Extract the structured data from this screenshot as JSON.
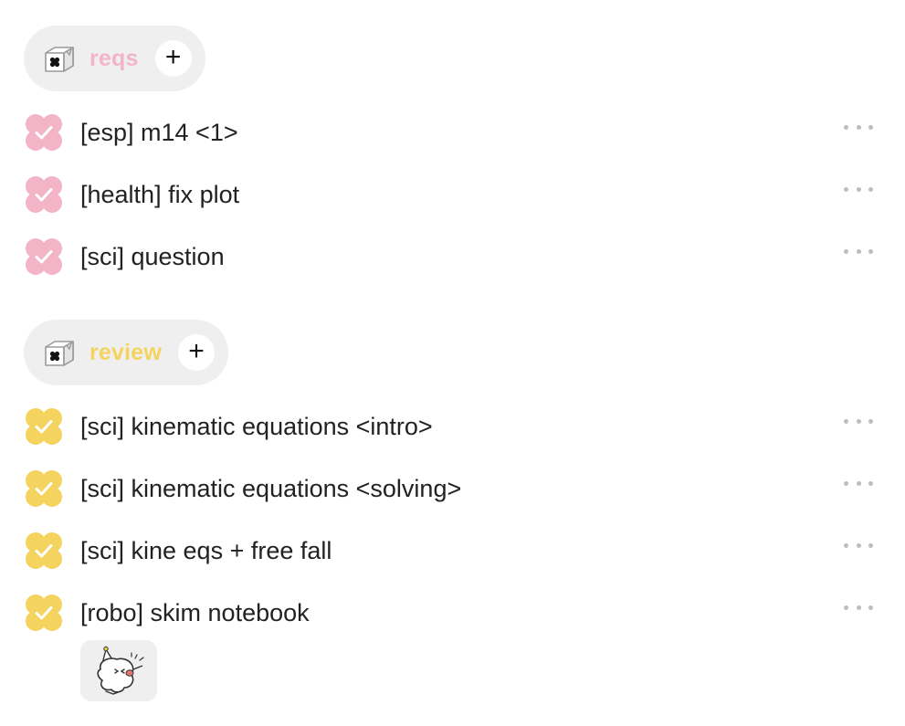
{
  "colors": {
    "pink": "#f3b4c8",
    "yellow": "#f4d35e",
    "pill_bg": "#efefef",
    "text": "#222222",
    "dots": "#bdbdbd"
  },
  "groups": [
    {
      "name": "reqs",
      "color": "#f3b4c8",
      "icon": "box-icon",
      "add_label": "+",
      "tasks": [
        {
          "title": "[esp] m14 <1>",
          "done": true
        },
        {
          "title": "[health] fix plot",
          "done": true
        },
        {
          "title": "[sci] question",
          "done": true
        }
      ]
    },
    {
      "name": "review",
      "color": "#f4d35e",
      "icon": "box-icon",
      "add_label": "+",
      "tasks": [
        {
          "title": "[sci] kinematic equations <intro>",
          "done": true
        },
        {
          "title": "[sci] kinematic equations <solving>",
          "done": true
        },
        {
          "title": "[sci] kine eqs + free fall",
          "done": true
        },
        {
          "title": "[robo] skim notebook",
          "done": true
        }
      ]
    }
  ],
  "sticker": {
    "icon": "party-ghost-sticker-icon"
  }
}
